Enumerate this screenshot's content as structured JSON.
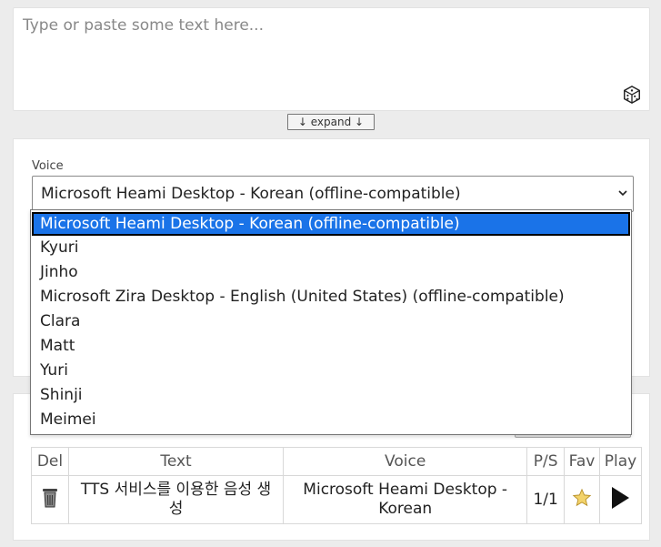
{
  "text_input": {
    "placeholder": "Type or paste some text here..."
  },
  "expand_label": "↓ expand ↓",
  "voice": {
    "label": "Voice",
    "selected": "Microsoft Heami Desktop - Korean (offline-compatible)",
    "options": [
      "Microsoft Heami Desktop - Korean (offline-compatible)",
      "Kyuri",
      "Jinho",
      "Microsoft Zira Desktop - English (United States) (offline-compatible)",
      "Clara",
      "Matt",
      "Yuri",
      "Shinji",
      "Meimei"
    ]
  },
  "history": {
    "headers": {
      "del": "Del",
      "text": "Text",
      "voice": "Voice",
      "ps": "P/S",
      "fav": "Fav",
      "play": "Play"
    },
    "rows": [
      {
        "text": "TTS 서비스를 이용한 음성 생성",
        "voice": "Microsoft Heami Desktop - Korean",
        "ps": "1/1"
      }
    ]
  },
  "colors": {
    "selected_option": "#1a73e8",
    "background": "#ececec",
    "star": "#f3d36b"
  },
  "icons": {
    "random": "dice-icon",
    "delete": "trash-icon",
    "favorite": "star-icon",
    "play": "play-icon",
    "dropdown": "chevron-down-icon"
  }
}
